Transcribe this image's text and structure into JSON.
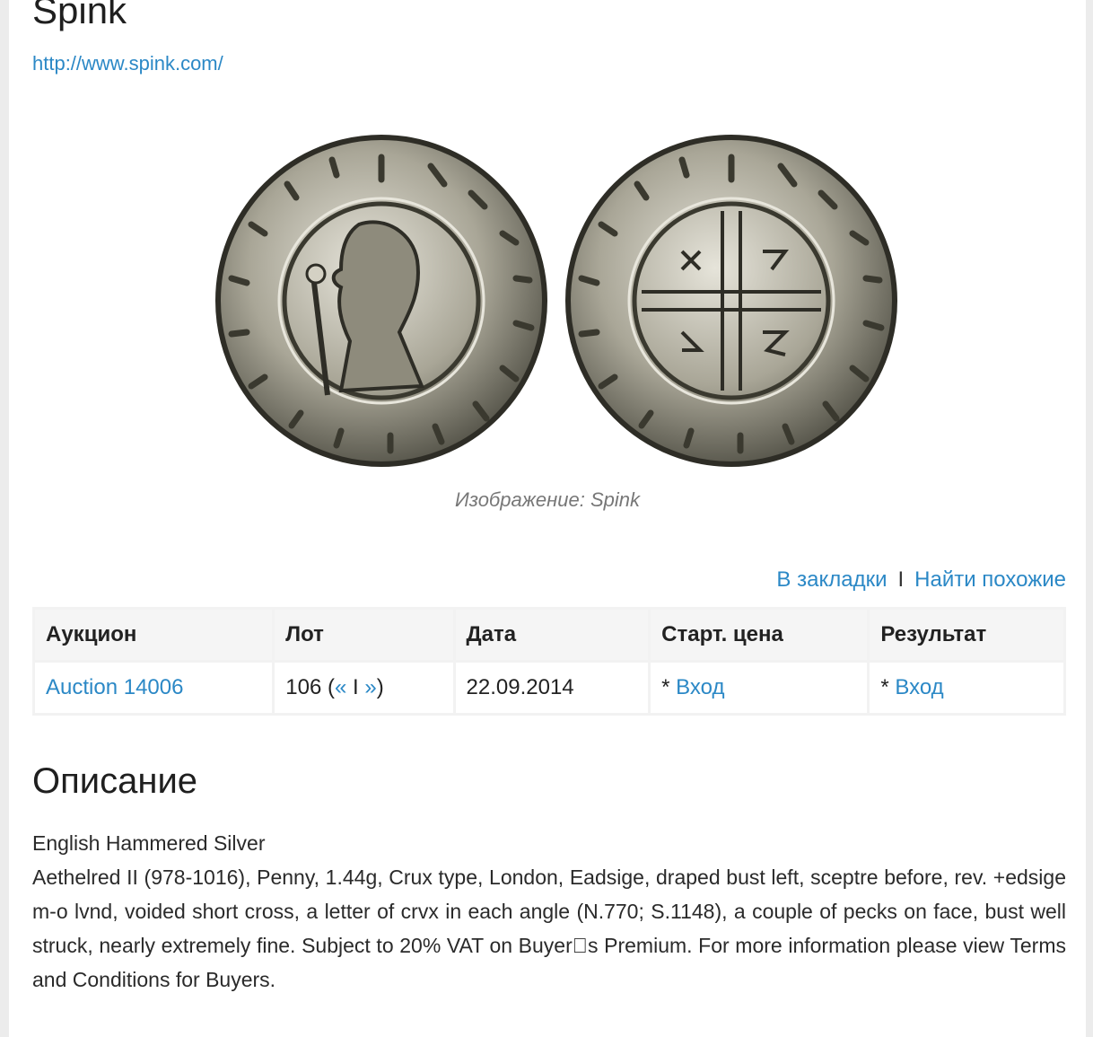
{
  "header": {
    "title": "Spink",
    "link": "http://www.spink.com/"
  },
  "image": {
    "caption": "Изображение: Spink",
    "obverse_icon": "coin-obverse-icon",
    "reverse_icon": "coin-reverse-icon"
  },
  "actions": {
    "bookmark": "В закладки",
    "separator": "I",
    "similar": "Найти похожие"
  },
  "table": {
    "headers": [
      "Аукцион",
      "Лот",
      "Дата",
      "Старт. цена",
      "Результат"
    ],
    "row": {
      "auction": "Auction 14006",
      "lot_number": "106 (",
      "lot_prev": "«",
      "lot_sep": " I ",
      "lot_next": "»",
      "lot_close": ")",
      "date": "22.09.2014",
      "start_prefix": "* ",
      "start_link": "Вход",
      "result_prefix": "* ",
      "result_link": "Вход"
    }
  },
  "description": {
    "title": "Описание",
    "line1": "English Hammered Silver",
    "body": "Aethelred II (978-1016), Penny, 1.44g, Crux type, London, Eadsige, draped bust left, sceptre before, rev. +edsige m-o lvnd, voided short cross, a letter of crvx in each angle (N.770; S.1148), a couple of pecks on face, bust well struck, nearly extremely fine. Subject to 20% VAT on Buyer\u0000s Premium. For more information please view Terms and Conditions for Buyers."
  },
  "colors": {
    "link": "#2b88c6",
    "coin_silver": "#b9b6a8"
  }
}
